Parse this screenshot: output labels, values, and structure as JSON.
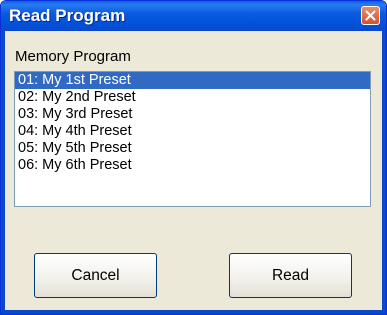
{
  "window": {
    "title": "Read Program"
  },
  "group_label": "Memory Program",
  "program_list": {
    "selected_index": 0,
    "items": [
      "01: My 1st Preset",
      "02: My 2nd Preset",
      "03: My 3rd Preset",
      "04: My 4th Preset",
      "05: My 5th Preset",
      "06: My 6th Preset"
    ]
  },
  "buttons": {
    "cancel": "Cancel",
    "read": "Read"
  },
  "colors": {
    "titlebar": "#0a5ce0",
    "selection": "#316ac5",
    "close_button": "#d6512e",
    "dialog_background": "#ece9d8"
  }
}
